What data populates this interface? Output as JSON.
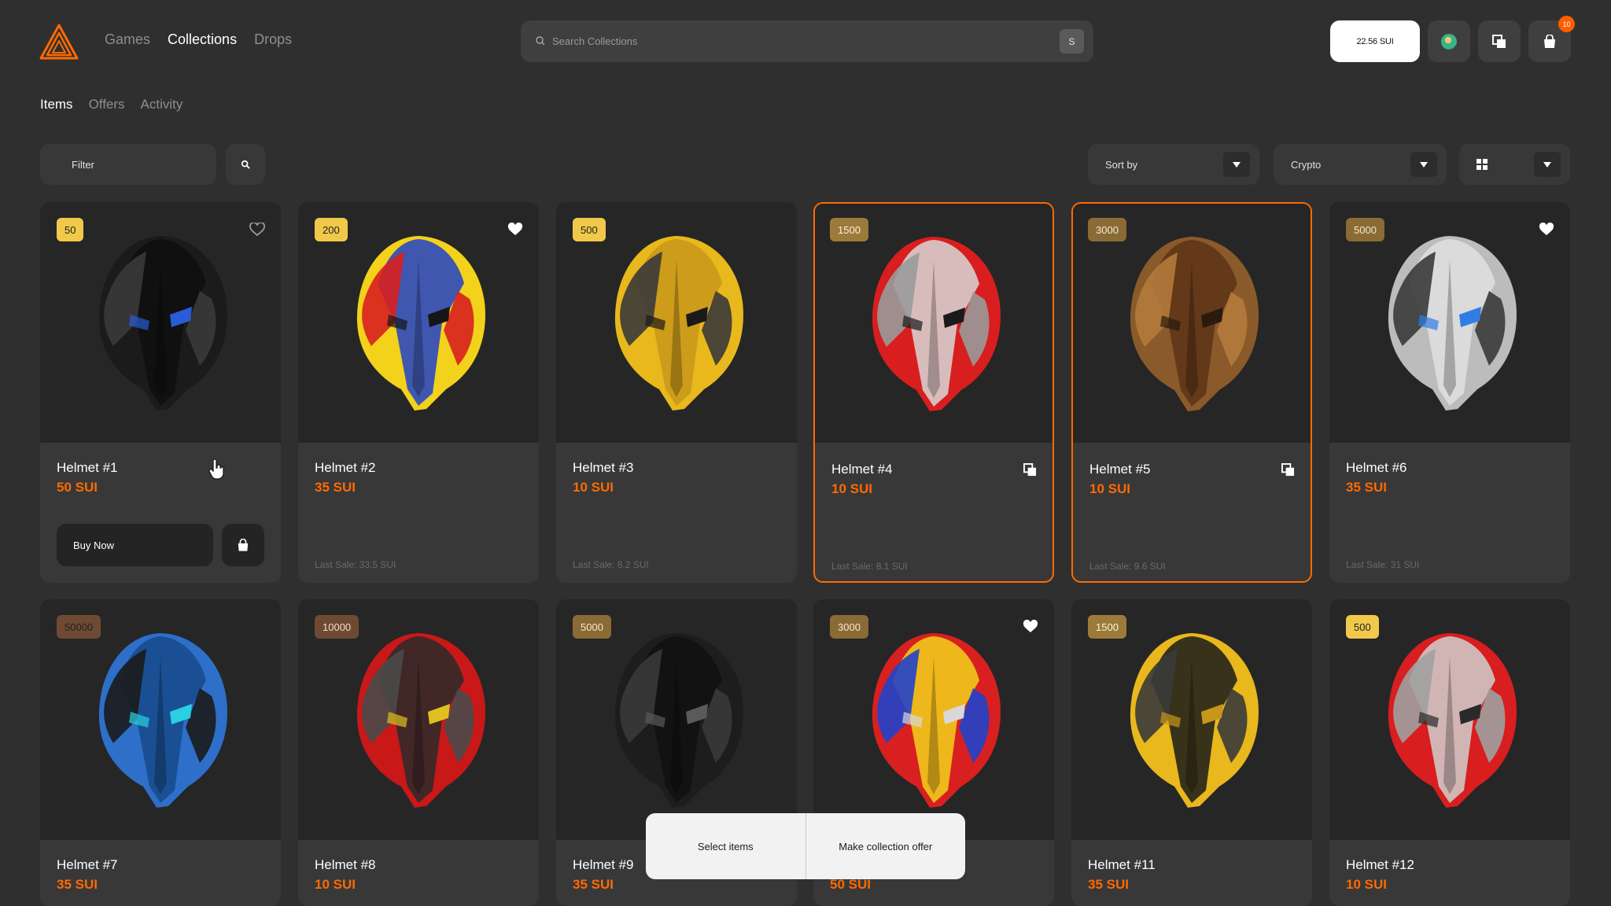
{
  "header": {
    "nav": [
      {
        "label": "Games",
        "active": false
      },
      {
        "label": "Collections",
        "active": true
      },
      {
        "label": "Drops",
        "active": false
      }
    ],
    "search": {
      "placeholder": "Search Collections",
      "shortcut": "S"
    },
    "balance": "22.56 SUI",
    "cart_count": "10"
  },
  "subtabs": [
    {
      "label": "Items",
      "active": true
    },
    {
      "label": "Offers",
      "active": false
    },
    {
      "label": "Activity",
      "active": false
    }
  ],
  "toolbar": {
    "filter_label": "Filter",
    "sort_label": "Sort by",
    "crypto_label": "Crypto"
  },
  "colors": {
    "accent": "#ff6a00",
    "background": "#2f2f2f",
    "card": "#383838",
    "badge_gold": "#f0c94a",
    "badge_bronze": "#8a6a35",
    "badge_copper": "#6e4a33"
  },
  "items": [
    {
      "name": "Helmet #1",
      "price": "50 SUI",
      "badge": "50",
      "last_sale": "",
      "favorited": false,
      "selected": false,
      "hovered": true
    },
    {
      "name": "Helmet #2",
      "price": "35 SUI",
      "badge": "200",
      "last_sale": "Last Sale: 33.5 SUI",
      "favorited": true,
      "selected": false
    },
    {
      "name": "Helmet #3",
      "price": "10 SUI",
      "badge": "500",
      "last_sale": "Last Sale: 8.2 SUI",
      "favorited": false,
      "selected": false
    },
    {
      "name": "Helmet #4",
      "price": "10 SUI",
      "badge": "1500",
      "last_sale": "Last Sale: 8.1 SUI",
      "favorited": false,
      "selected": true
    },
    {
      "name": "Helmet #5",
      "price": "10 SUI",
      "badge": "3000",
      "last_sale": "Last Sale: 9.6 SUI",
      "favorited": false,
      "selected": true
    },
    {
      "name": "Helmet #6",
      "price": "35 SUI",
      "badge": "5000",
      "last_sale": "Last Sale: 31 SUI",
      "favorited": true,
      "selected": false
    },
    {
      "name": "Helmet #7",
      "price": "35 SUI",
      "badge": "50000",
      "favorited": false
    },
    {
      "name": "Helmet #8",
      "price": "10 SUI",
      "badge": "10000",
      "favorited": false
    },
    {
      "name": "Helmet #9",
      "price": "35 SUI",
      "badge": "5000",
      "favorited": false
    },
    {
      "name": "",
      "price": "50 SUI",
      "badge": "3000",
      "favorited": true
    },
    {
      "name": "Helmet #11",
      "price": "35 SUI",
      "badge": "1500",
      "favorited": false
    },
    {
      "name": "Helmet #12",
      "price": "10 SUI",
      "badge": "500",
      "favorited": false
    }
  ],
  "buy_now_label": "Buy Now",
  "bottom_bar": {
    "select_items": "Select items",
    "make_offer": "Make collection offer"
  }
}
